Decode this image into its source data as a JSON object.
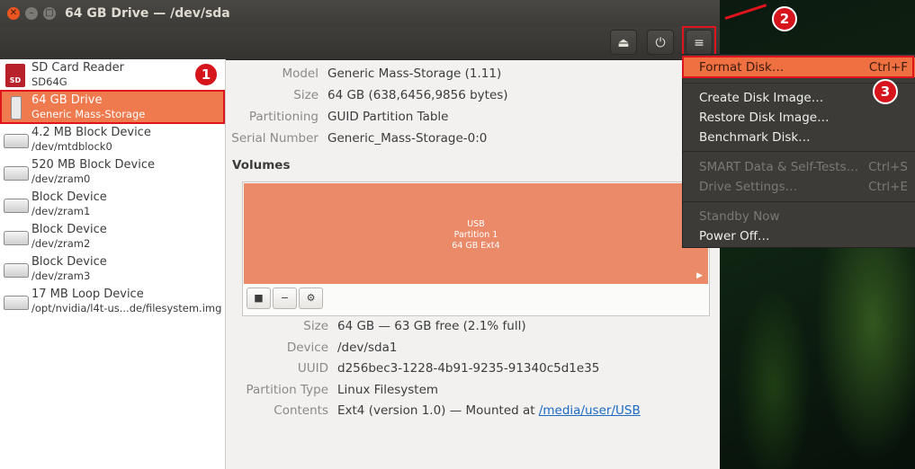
{
  "window": {
    "title": "64 GB Drive — /dev/sda"
  },
  "icons": {
    "close": "close-icon",
    "minimize": "minimize-icon",
    "maximize": "maximize-icon",
    "eject": "eject-icon",
    "power": "power-icon",
    "menu": "hamburger-menu-icon",
    "stop": "stop-icon",
    "minus": "minus-icon",
    "gears": "gears-icon",
    "play": "play-icon"
  },
  "sidebar": {
    "devices": [
      {
        "name": "SD Card Reader",
        "sub": "SD64G",
        "icon_label": "SD"
      },
      {
        "name": "64 GB Drive",
        "sub": "Generic Mass-Storage"
      },
      {
        "name": "4.2 MB Block Device",
        "sub": "/dev/mtdblock0"
      },
      {
        "name": "520 MB Block Device",
        "sub": "/dev/zram0"
      },
      {
        "name": "Block Device",
        "sub": "/dev/zram1"
      },
      {
        "name": "Block Device",
        "sub": "/dev/zram2"
      },
      {
        "name": "Block Device",
        "sub": "/dev/zram3"
      },
      {
        "name": "17 MB Loop Device",
        "sub": "/opt/nvidia/l4t-us...de/filesystem.img"
      }
    ]
  },
  "drive_info": {
    "model_label": "Model",
    "model": "Generic Mass-Storage (1.11)",
    "size_label": "Size",
    "size": "64 GB (638,6456,9856 bytes)",
    "partitioning_label": "Partitioning",
    "partitioning": "GUID Partition Table",
    "serial_label": "Serial Number",
    "serial": "Generic_Mass-Storage-0:0"
  },
  "volumes": {
    "heading": "Volumes",
    "partition": {
      "line1": "USB",
      "line2": "Partition 1",
      "line3": "64 GB Ext4"
    },
    "play_glyph": "▶"
  },
  "volume_info": {
    "size_label": "Size",
    "size": "64 GB — 63 GB free (2.1% full)",
    "device_label": "Device",
    "device": "/dev/sda1",
    "uuid_label": "UUID",
    "uuid": "d256bec3-1228-4b91-9235-91340c5d1e35",
    "ptype_label": "Partition Type",
    "ptype": "Linux Filesystem",
    "contents_label": "Contents",
    "contents": "Ext4 (version 1.0) — Mounted at",
    "mount_link": "/media/user/USB"
  },
  "menu": {
    "format_disk": "Format Disk…",
    "format_disk_key": "Ctrl+F",
    "create_image": "Create Disk Image…",
    "restore_image": "Restore Disk Image…",
    "benchmark": "Benchmark Disk…",
    "smart": "SMART Data & Self-Tests…",
    "smart_key": "Ctrl+S",
    "drive_settings": "Drive Settings…",
    "drive_settings_key": "Ctrl+E",
    "standby": "Standby Now",
    "power_off": "Power Off…"
  },
  "annotations": {
    "one": "1",
    "two": "2",
    "three": "3"
  },
  "colors": {
    "accent": "#ee7a4e",
    "highlight": "#e0141c",
    "menu_bg": "#3c3b37"
  }
}
